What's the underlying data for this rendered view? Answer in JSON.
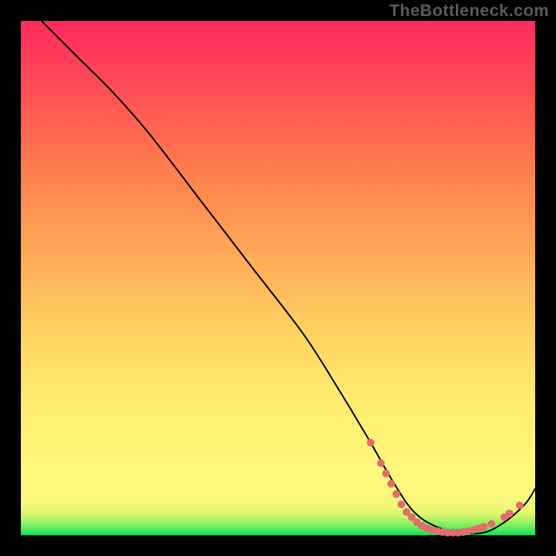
{
  "watermark": "TheBottleneck.com",
  "chart_data": {
    "type": "line",
    "title": "",
    "xlabel": "",
    "ylabel": "",
    "xlim": [
      0,
      100
    ],
    "ylim": [
      0,
      100
    ],
    "series": [
      {
        "name": "curve",
        "x": [
          4,
          8,
          12,
          18,
          25,
          35,
          45,
          55,
          62,
          68,
          72,
          76,
          80,
          85,
          90,
          94,
          98,
          100
        ],
        "y": [
          100,
          96,
          92,
          86,
          78,
          65,
          52,
          39,
          28,
          18,
          11,
          5,
          2,
          0.5,
          0.5,
          2.5,
          6,
          9
        ]
      }
    ],
    "markers": [
      {
        "x": 68,
        "y": 18
      },
      {
        "x": 70,
        "y": 14
      },
      {
        "x": 71,
        "y": 12
      },
      {
        "x": 72,
        "y": 10
      },
      {
        "x": 73,
        "y": 8
      },
      {
        "x": 74,
        "y": 6
      },
      {
        "x": 75,
        "y": 4.5
      },
      {
        "x": 76,
        "y": 3.5
      },
      {
        "x": 77,
        "y": 2.5
      },
      {
        "x": 78,
        "y": 1.8
      },
      {
        "x": 79,
        "y": 1.3
      },
      {
        "x": 80,
        "y": 1.0
      },
      {
        "x": 81,
        "y": 0.8
      },
      {
        "x": 82,
        "y": 0.6
      },
      {
        "x": 83,
        "y": 0.5
      },
      {
        "x": 84,
        "y": 0.5
      },
      {
        "x": 85,
        "y": 0.5
      },
      {
        "x": 86,
        "y": 0.6
      },
      {
        "x": 87,
        "y": 0.8
      },
      {
        "x": 88,
        "y": 1.0
      },
      {
        "x": 89,
        "y": 1.3
      },
      {
        "x": 90,
        "y": 1.6
      },
      {
        "x": 91.5,
        "y": 2.2
      },
      {
        "x": 94,
        "y": 3.5
      },
      {
        "x": 95,
        "y": 4.2
      },
      {
        "x": 97,
        "y": 5.8
      }
    ],
    "curve_color": "#000000",
    "marker_color": "#e26d6d"
  }
}
